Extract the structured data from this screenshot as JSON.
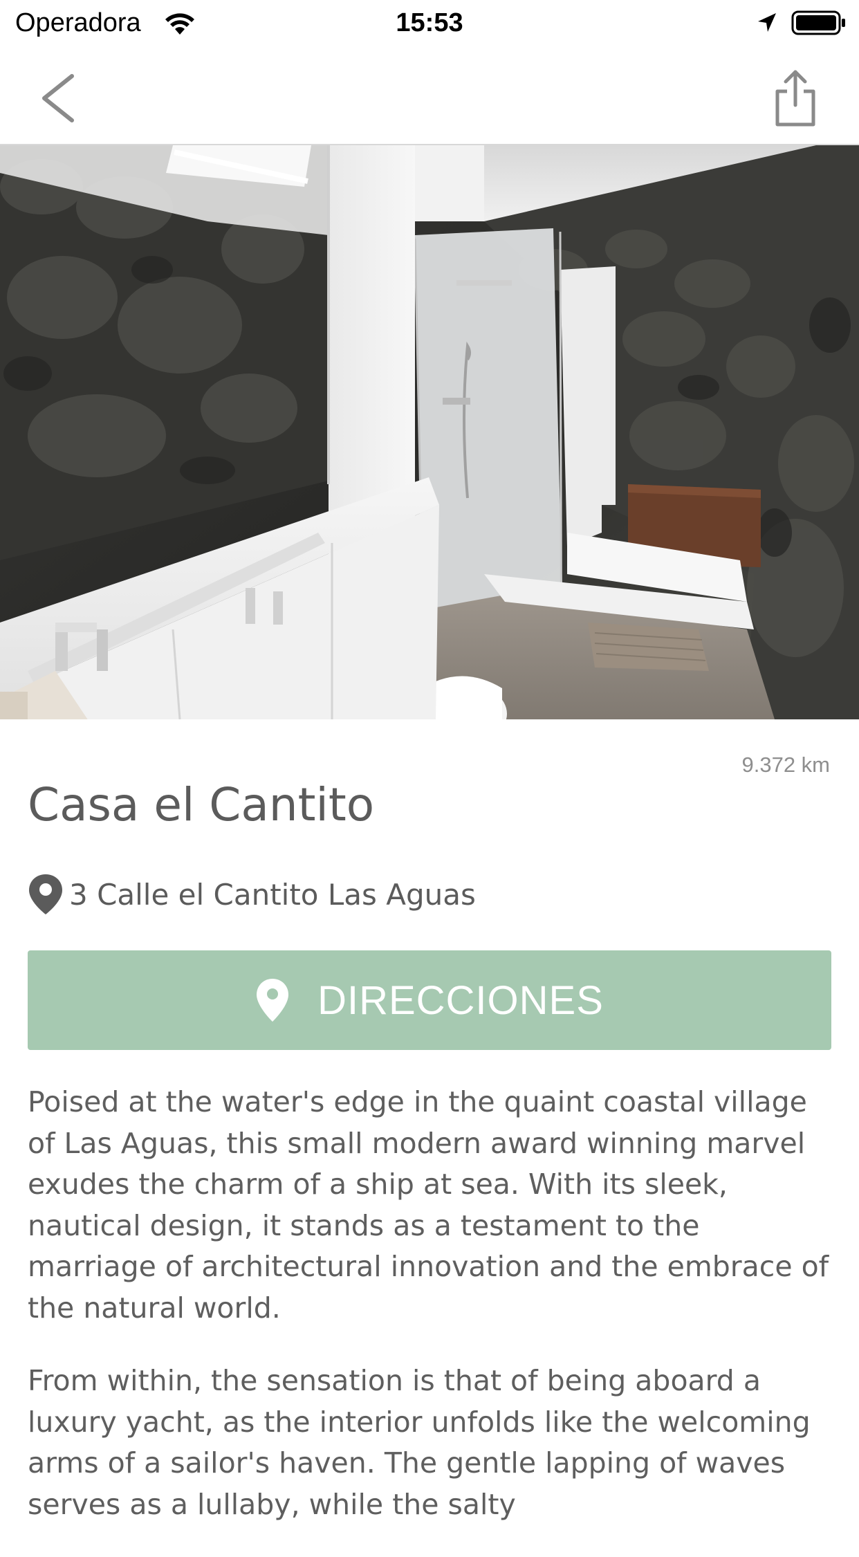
{
  "status_bar": {
    "carrier": "Operadora",
    "time": "15:53",
    "icons": [
      "wifi-icon",
      "location-arrow-icon",
      "battery-icon"
    ]
  },
  "nav": {
    "back_icon": "chevron-left-icon",
    "share_icon": "share-icon"
  },
  "hero": {
    "alt": "bathroom-photo"
  },
  "place": {
    "distance": "9.372 km",
    "title": "Casa el Cantito",
    "address": "3 Calle el Cantito Las Aguas",
    "address_icon": "map-pin-icon"
  },
  "directions": {
    "label": "DIRECCIONES",
    "icon": "map-pin-icon",
    "color": "#a6c9b1"
  },
  "description": {
    "paragraphs": [
      "Poised at the water's edge in the quaint coastal village of Las Aguas, this small modern award winning marvel exudes the charm of a ship at sea. With its sleek, nautical design, it stands as a testament to the marriage of architectural innovation and the embrace of the natural world.",
      "From within, the sensation is that of being aboard a luxury yacht, as the interior unfolds like the welcoming arms of a sailor's haven. The gentle lapping of waves serves as a lullaby, while the salty"
    ]
  },
  "colors": {
    "text": "#5b5b5b",
    "secondary_text": "#8e8e8e",
    "accent": "#a6c9b1"
  }
}
